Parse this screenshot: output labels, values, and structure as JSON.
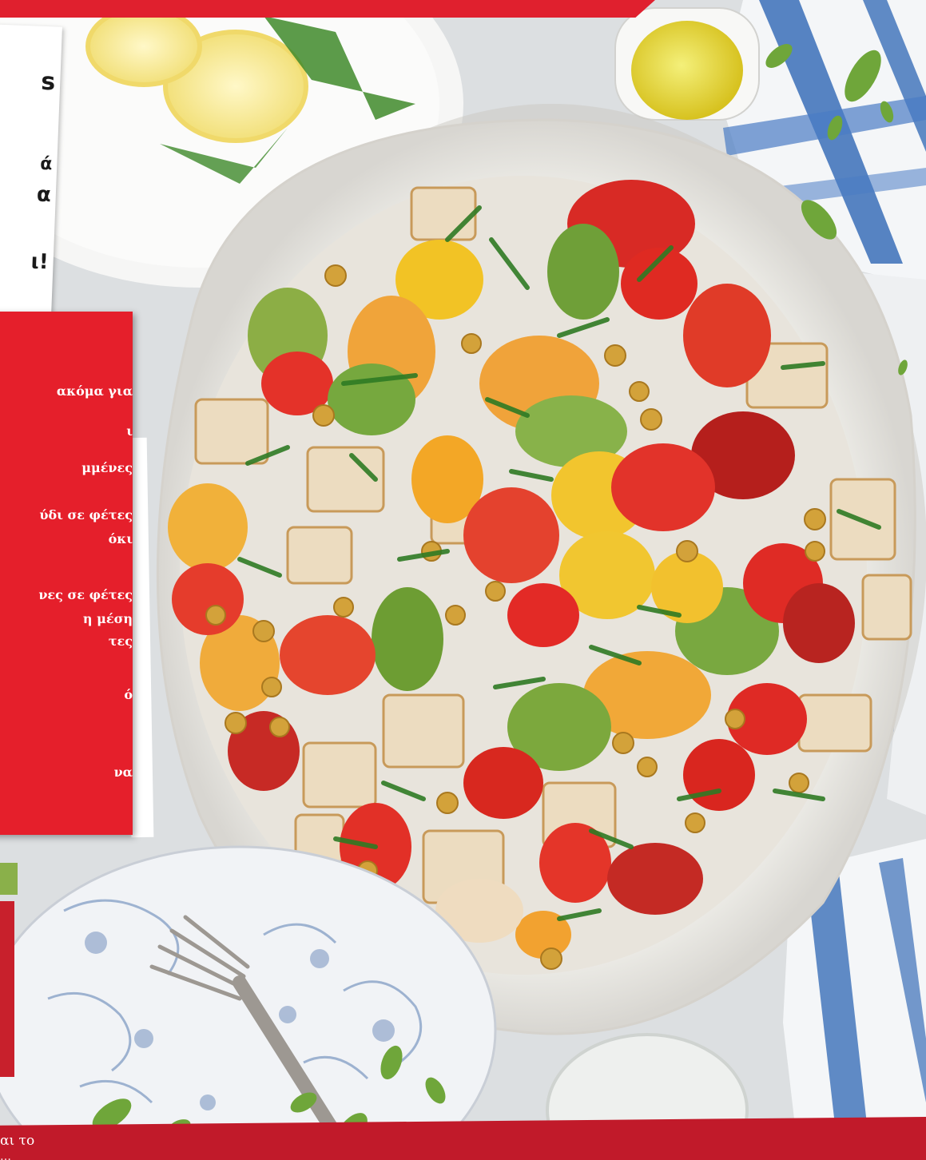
{
  "white_card": {
    "lines": [
      "s",
      "α",
      "ά",
      "ι!"
    ]
  },
  "ingredients_card": {
    "lines": [
      "ακόμα για",
      "ι",
      "μμένες",
      "ύδι σε φέτες",
      "όκι",
      "νες σε φέτες",
      "η μέση",
      "τες",
      "ό",
      "να"
    ]
  },
  "bottom": {
    "line1": "αι το",
    "line2": "…"
  },
  "colors": {
    "brand_red": "#e51f2b",
    "dark_red": "#c11a2a",
    "leaf_green": "#6fa63a"
  }
}
